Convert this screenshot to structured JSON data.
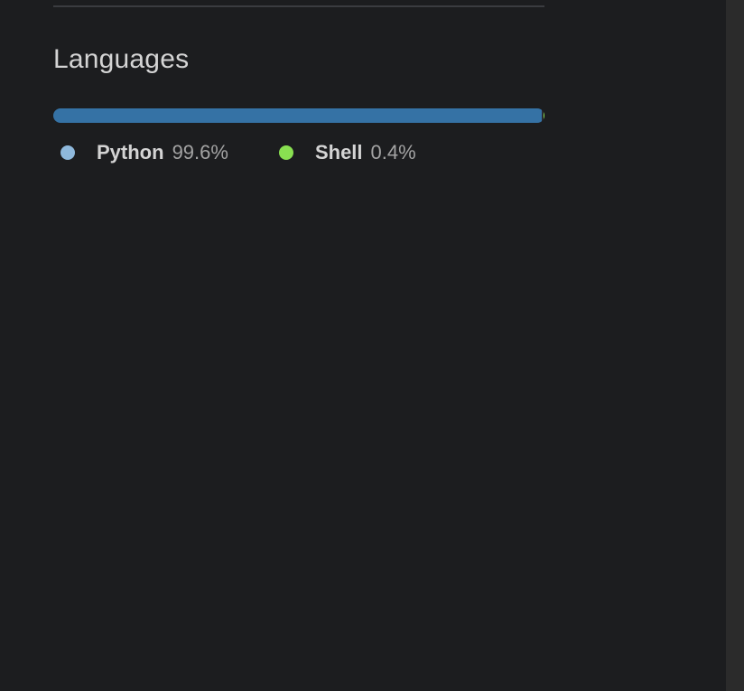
{
  "languages": {
    "title": "Languages",
    "items": [
      {
        "name": "Python",
        "percent_label": "99.6%",
        "percent": 99.6,
        "dot_color": "#8fb9dc",
        "bar_color": "#3572a5"
      },
      {
        "name": "Shell",
        "percent_label": "0.4%",
        "percent": 0.4,
        "dot_color": "#89e051",
        "bar_color": "#89e051"
      }
    ]
  }
}
